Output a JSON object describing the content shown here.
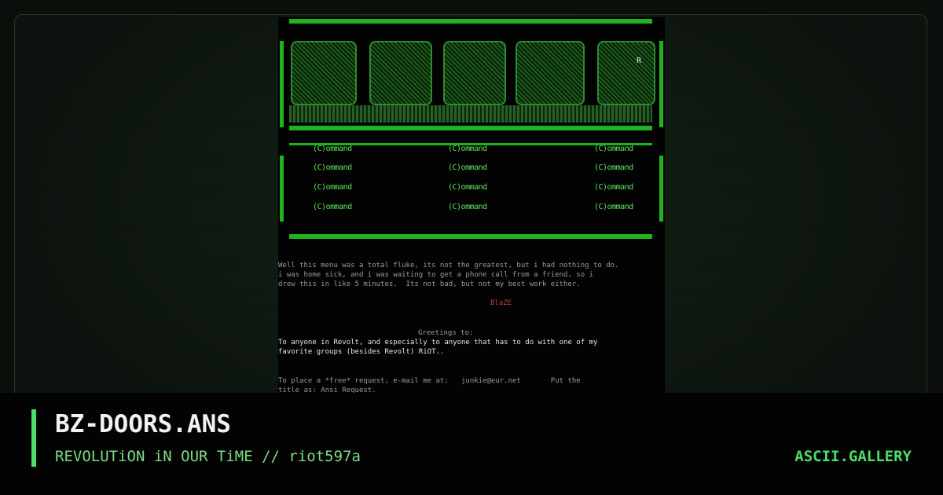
{
  "card": {
    "title": "BZ-DOORS.ANS",
    "subtitle": "REVOLUTiON iN OUR TiME // riot597a",
    "brand": "ASCII.GALLERY"
  },
  "artwork": {
    "logo_tag": "R",
    "commands": [
      "(C)ommand",
      "(C)ommand",
      "(C)ommand",
      "(C)ommand",
      "(C)ommand",
      "(C)ommand",
      "(C)ommand",
      "(C)ommand",
      "(C)ommand",
      "(C)ommand",
      "(C)ommand",
      "(C)ommand"
    ],
    "notes_line1": "Well this menu was a total fluke, its not the greatest, but i had nothing to do.",
    "notes_line2": "i was home sick, and i was waiting to get a phone call from a friend, so i",
    "notes_line3": "drew this in like 5 minutes.  Its not bad, but not my best work either.",
    "signature": "BlaZE",
    "greetings_heading": "Greetings to:",
    "greetings_line1": "To anyone in Revolt, and especially to anyone that has to do with one of my",
    "greetings_line2": "favorite groups (besides Revolt) RiOT..",
    "request_line1": "To place a *free* request, e-mail me at:   junkie@eur.net       Put the",
    "request_line2": "title as: Ansi Request."
  },
  "colors": {
    "accent": "#4ade6a",
    "background": "#0b0f0c",
    "art_green": "#1fb31f"
  }
}
